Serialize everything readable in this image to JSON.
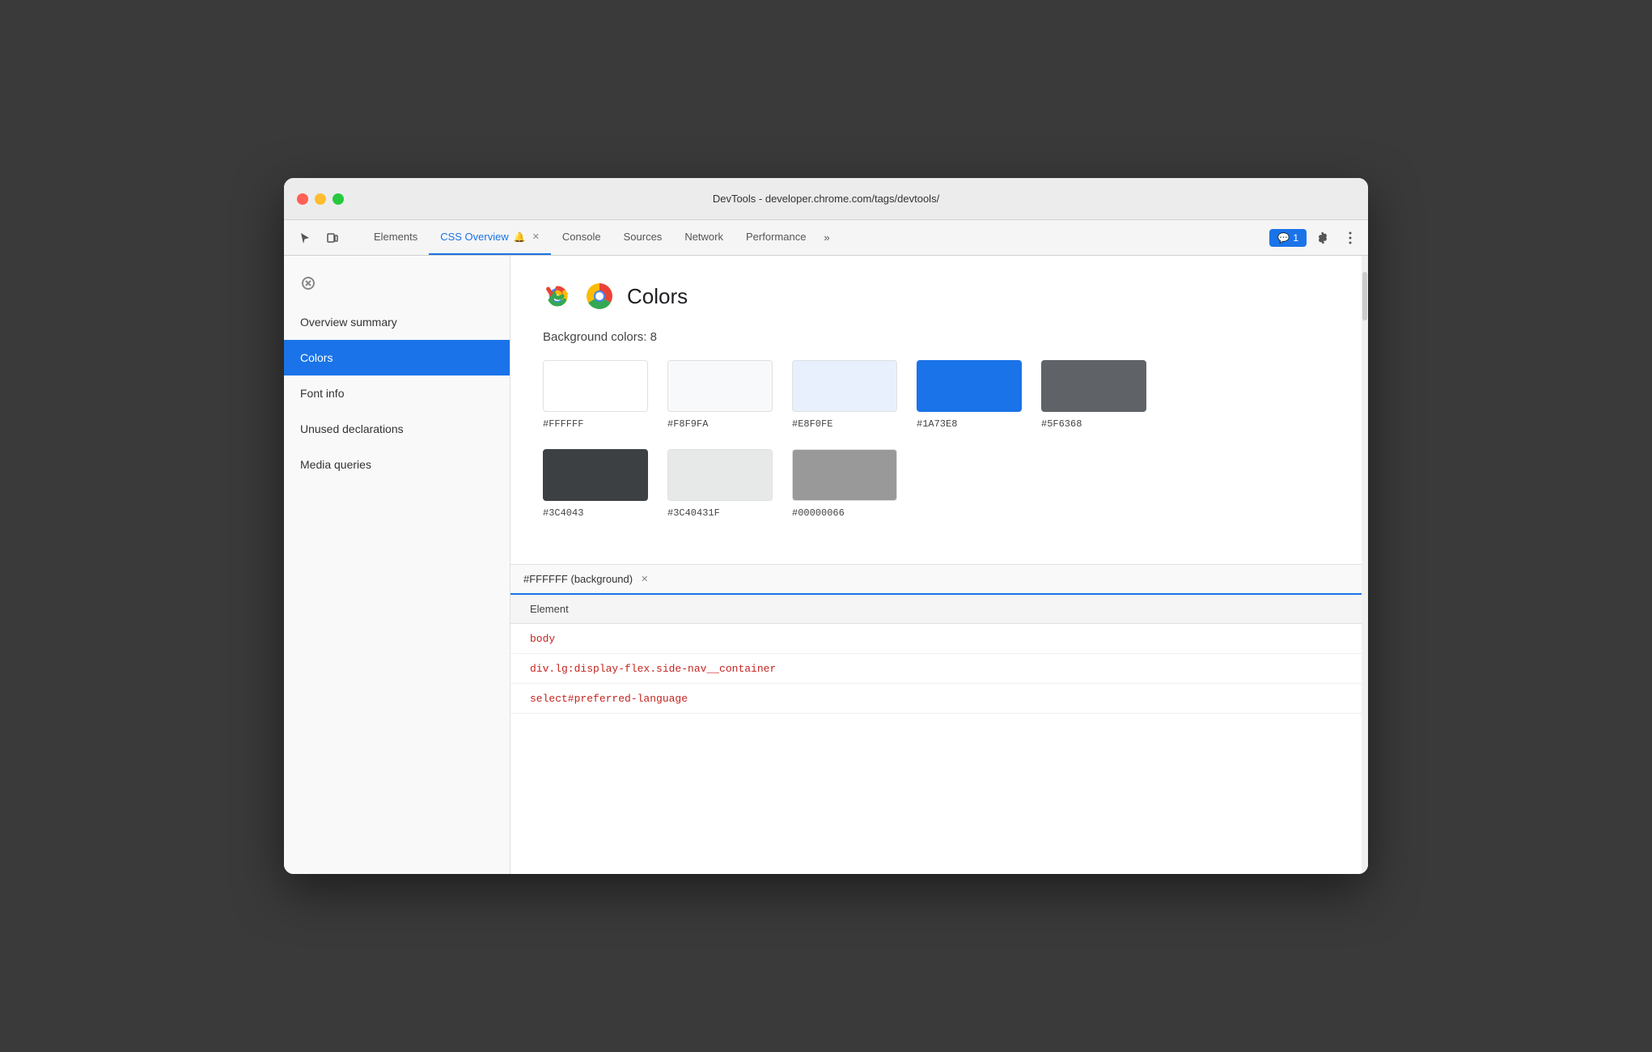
{
  "window": {
    "title": "DevTools - developer.chrome.com/tags/devtools/"
  },
  "tabs": [
    {
      "label": "Elements",
      "active": false,
      "closable": false
    },
    {
      "label": "CSS Overview",
      "active": true,
      "closable": true,
      "has_icon": true
    },
    {
      "label": "Console",
      "active": false,
      "closable": false
    },
    {
      "label": "Sources",
      "active": false,
      "closable": false
    },
    {
      "label": "Network",
      "active": false,
      "closable": false
    },
    {
      "label": "Performance",
      "active": false,
      "closable": false
    }
  ],
  "more_tabs_label": "»",
  "feedback_btn": {
    "label": "1",
    "icon": "💬"
  },
  "sidebar": {
    "items": [
      {
        "label": "Overview summary",
        "active": false
      },
      {
        "label": "Colors",
        "active": true
      },
      {
        "label": "Font info",
        "active": false
      },
      {
        "label": "Unused declarations",
        "active": false
      },
      {
        "label": "Media queries",
        "active": false
      }
    ]
  },
  "colors_section": {
    "title": "Colors",
    "background_label": "Background colors: 8",
    "swatches": [
      {
        "hex": "#FFFFFF",
        "color": "#FFFFFF",
        "border": true
      },
      {
        "hex": "#F8F9FA",
        "color": "#F8F9FA",
        "border": true
      },
      {
        "hex": "#E8F0FE",
        "color": "#E8F0FE",
        "border": true
      },
      {
        "hex": "#1A73E8",
        "color": "#1A73E8",
        "border": false
      },
      {
        "hex": "#5F6368",
        "color": "#5F6368",
        "border": false
      },
      {
        "hex": "#3C4043",
        "color": "#3C4043",
        "border": false
      },
      {
        "hex": "#3C40431F",
        "color": "#e8e8e8",
        "border": true
      },
      {
        "hex": "#00000066",
        "color": "#b0b0b0",
        "border": true
      }
    ]
  },
  "bottom_panel": {
    "active_tab": "#FFFFFF (background)",
    "element_header": "Element",
    "elements": [
      {
        "selector": "body"
      },
      {
        "selector": "div.lg:display-flex.side-nav__container"
      },
      {
        "selector": "select#preferred-language"
      }
    ]
  }
}
